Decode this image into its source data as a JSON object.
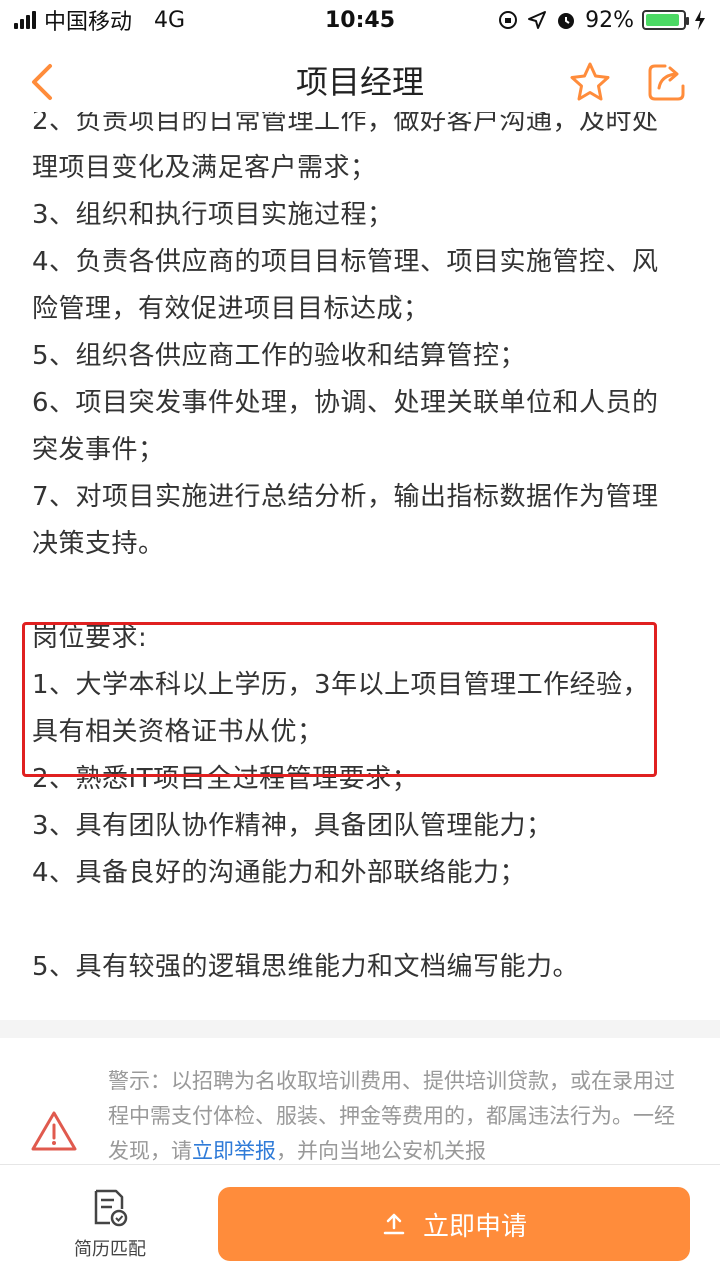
{
  "status_bar": {
    "carrier": "中国移动",
    "network": "4G",
    "time": "10:45",
    "battery_percent": "92%",
    "battery_level": 0.92
  },
  "header": {
    "title": "项目经理"
  },
  "job_description": {
    "lines": [
      "2、负责项目的日常管理工作，做好客户沟通，及时处",
      "理项目变化及满足客户需求；",
      "3、组织和执行项目实施过程；",
      "4、负责各供应商的项目目标管理、项目实施管控、风",
      "险管理，有效促进项目目标达成；",
      "5、组织各供应商工作的验收和结算管控；",
      "6、项目突发事件处理，协调、处理关联单位和人员的",
      "突发事件；",
      "7、对项目实施进行总结分析，输出指标数据作为管理",
      "决策支持。"
    ]
  },
  "requirements": {
    "heading": "岗位要求:",
    "lines": [
      "1、大学本科以上学历，3年以上项目管理工作经验，",
      "具有相关资格证书从优；",
      "2、熟悉IT项目全过程管理要求；",
      "3、具有团队协作精神，具备团队管理能力；",
      "4、具备良好的沟通能力和外部联络能力；",
      "5、具有较强的逻辑思维能力和文档编写能力。"
    ]
  },
  "warning": {
    "text_before": "警示：以招聘为名收取培训费用、提供培训贷款，或在录用过程中需支付体检、服装、押金等费用的，都属违法行为。一经发现，请",
    "report_link": "立即举报",
    "text_after": "，并向当地公安机关报"
  },
  "bottom_bar": {
    "resume_match_label": "简历匹配",
    "apply_label": "立即申请"
  },
  "colors": {
    "accent": "#ff8c3b",
    "highlight_border": "#e02020",
    "link": "#2f7bd8",
    "battery": "#4cd964"
  }
}
